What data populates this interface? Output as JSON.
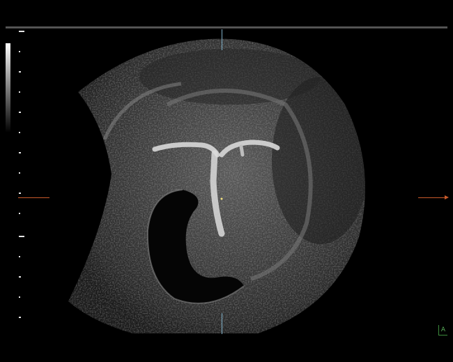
{
  "image": {
    "subject": "ultrasound scan",
    "orientation_marker": "A"
  },
  "colors": {
    "background": "#000000",
    "center_marker": "#7fb0c8",
    "focus_marker": "#c85a2a",
    "orientation_marker": "#5ab05a"
  }
}
